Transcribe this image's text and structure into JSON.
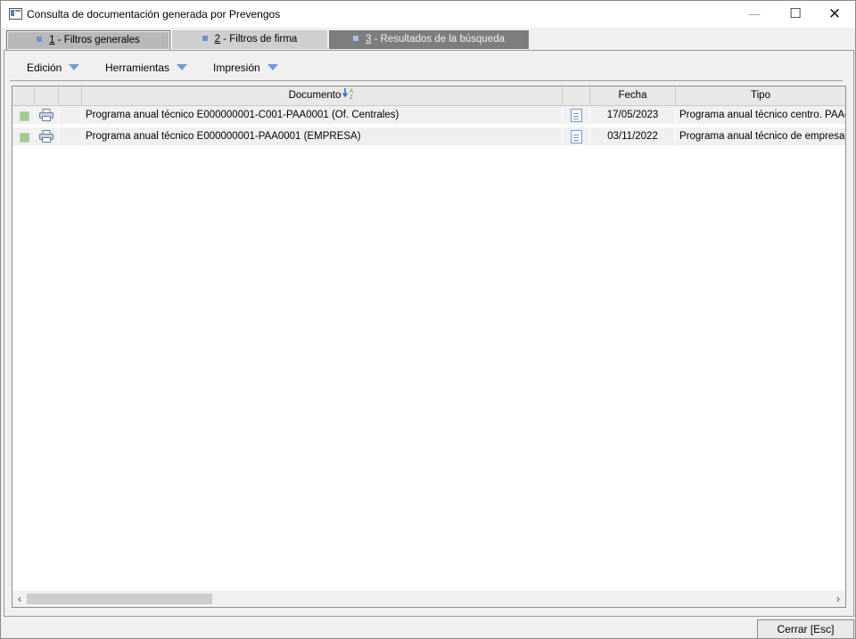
{
  "window": {
    "title": "Consulta de documentación generada por Prevengos",
    "minimize": "—",
    "maximize": "☐",
    "close": "✕"
  },
  "tabs": [
    {
      "num": "1",
      "label": " - Filtros generales",
      "active": true
    },
    {
      "num": "2",
      "label": " - Filtros de firma",
      "active": false
    },
    {
      "num": "3",
      "label": " - Resultados de la búsqueda",
      "active": false
    }
  ],
  "menus": [
    {
      "label": "Edición"
    },
    {
      "label": "Herramientas"
    },
    {
      "label": "Impresión"
    }
  ],
  "table": {
    "columns": [
      "",
      "",
      "",
      "Documento",
      "",
      "Fecha",
      "Tipo"
    ],
    "sorted_column": "Documento",
    "rows": [
      {
        "documento": "Programa anual técnico E000000001-C001-PAA0001 (Of. Centrales)",
        "fecha": "17/05/2023",
        "tipo": "Programa anual técnico centro. PAAc"
      },
      {
        "documento": "Programa anual técnico E000000001-PAA0001 (EMPRESA)",
        "fecha": "03/11/2022",
        "tipo": "Programa anual técnico de empresa. PAAe"
      }
    ]
  },
  "scrollbar": {
    "left": "‹",
    "right": "›"
  },
  "footer": {
    "close_label": "Cerrar  [Esc]"
  },
  "colors": {
    "accent": "#6f9ad8",
    "tab_active": "#b8b8b8",
    "tab_results": "#7d7d7d"
  }
}
